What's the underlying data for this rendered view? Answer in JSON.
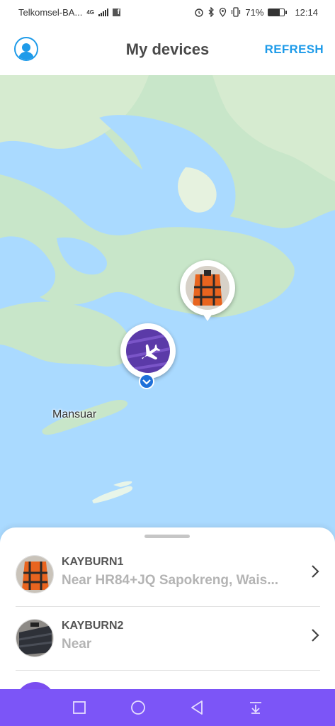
{
  "status_bar": {
    "carrier": "Telkomsel-BA...",
    "network": "4G",
    "battery_percent": "71%",
    "time": "12:14"
  },
  "header": {
    "title": "My devices",
    "refresh_label": "REFRESH"
  },
  "map": {
    "place_label": "Mansuar",
    "colors": {
      "water": "#aadaff",
      "land": "#c8e6c9",
      "land_light": "#e6f2df"
    }
  },
  "devices": [
    {
      "name": "KAYBURN1",
      "address": "Near HR84+JQ Sapokreng, Wais...",
      "thumb": "orange-backpack"
    },
    {
      "name": "KAYBURN2",
      "address": "Near",
      "thumb": "dark-suitcase"
    }
  ],
  "accent": {
    "primary": "#1e9be9",
    "nav": "#7c55f7"
  },
  "nav": [
    "square-icon",
    "circle-icon",
    "back-triangle-icon",
    "download-icon"
  ]
}
